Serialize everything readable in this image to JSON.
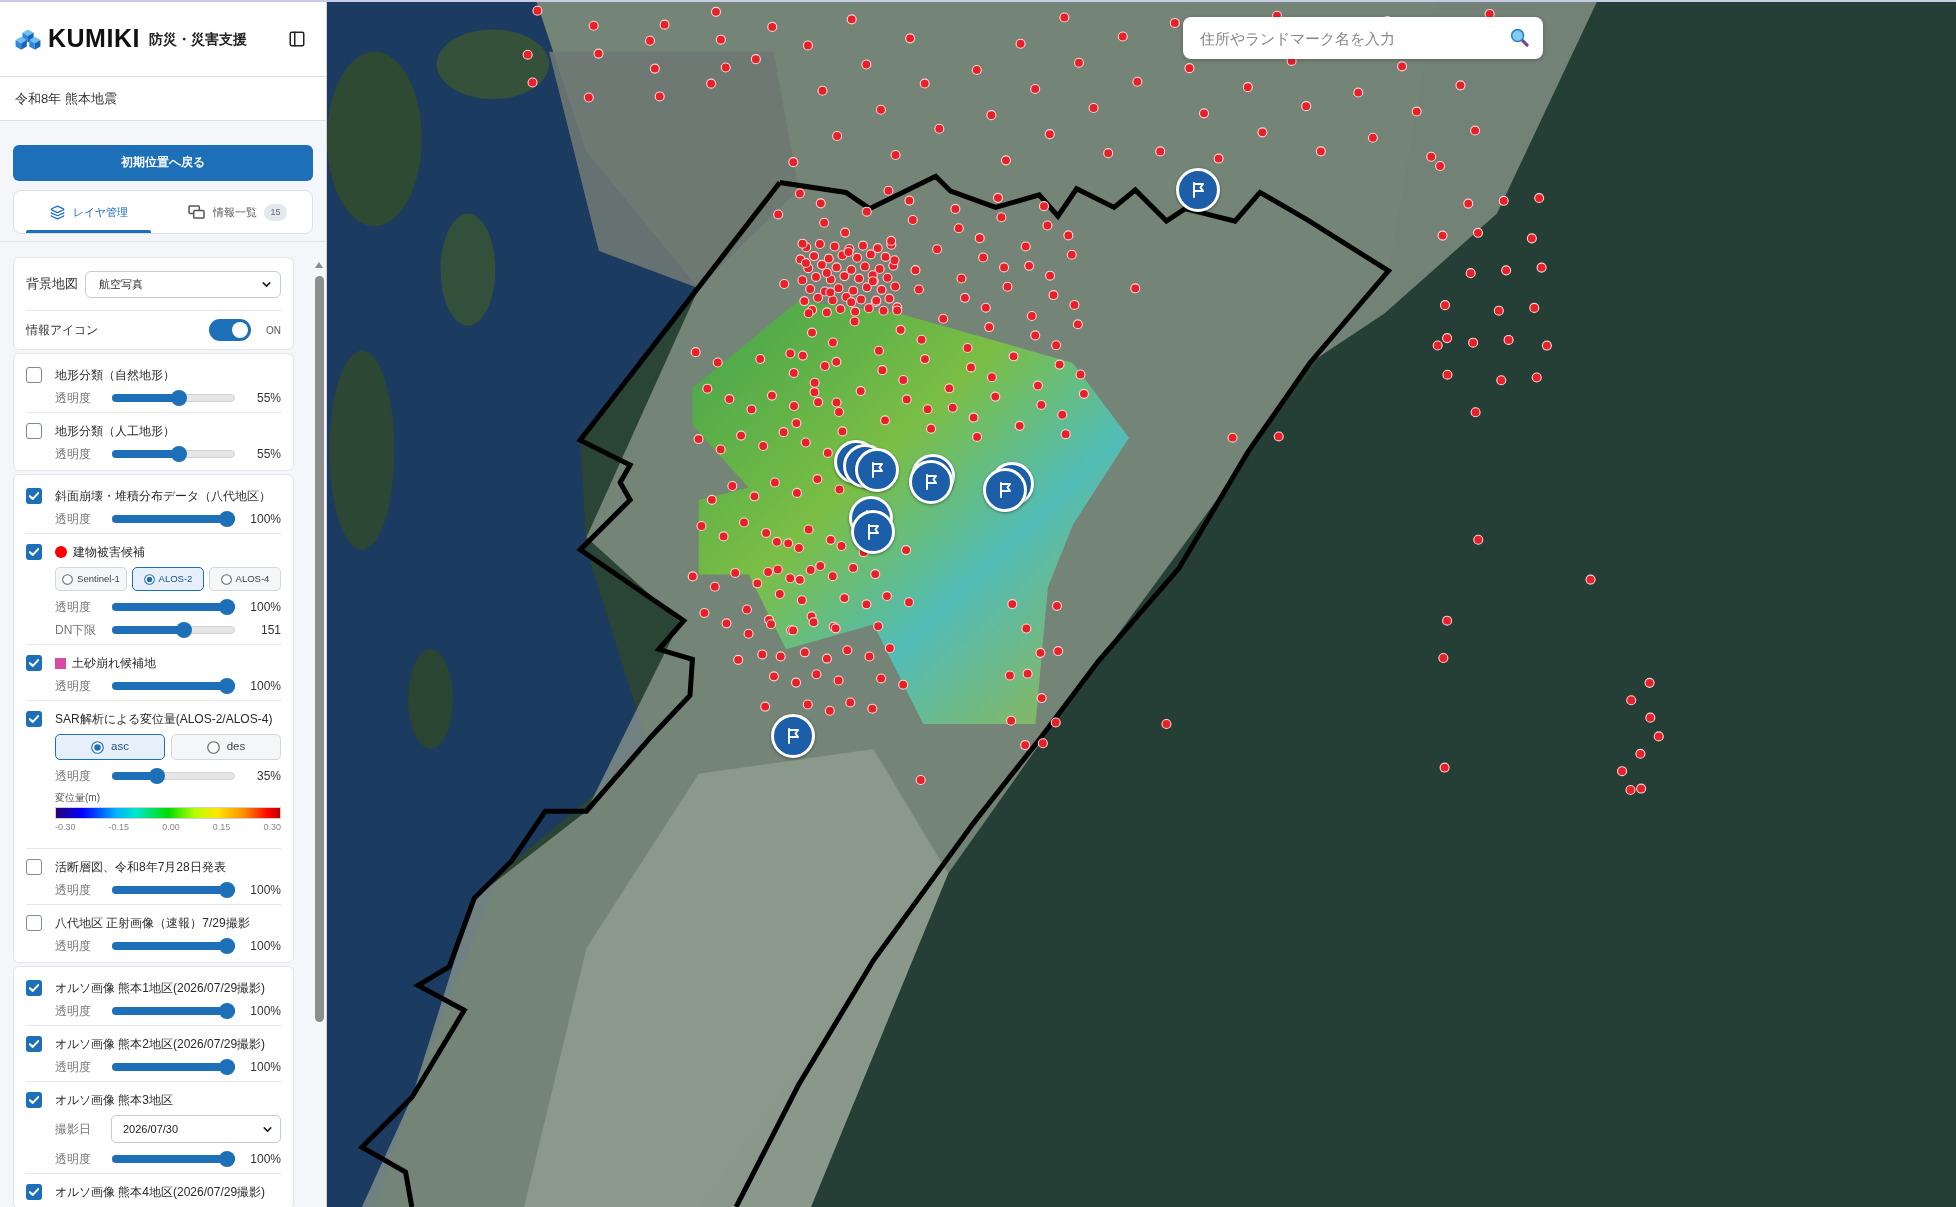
{
  "sidebar": {
    "logo": {
      "name": "KUMIKI",
      "tagline": "防災・災害支援"
    },
    "event_title": "令和8年 熊本地震",
    "reset_button": "初期位置へ戻る",
    "tabs": [
      {
        "label": "レイヤ管理",
        "selected": true
      },
      {
        "label": "情報一覧",
        "selected": false,
        "badge": "15"
      }
    ],
    "basemap": {
      "label": "背景地図",
      "value": "航空写真"
    },
    "info_icons": {
      "label": "情報アイコン",
      "on": true,
      "state_label": "ON"
    },
    "layer_groups": [
      {
        "layers": [
          {
            "name": "地形分類（自然地形）",
            "checked": false,
            "controls": [
              {
                "kind": "slider",
                "label": "透明度",
                "level": 0.55,
                "reading": "55%"
              }
            ]
          },
          {
            "name": "地形分類（人工地形）",
            "checked": false,
            "controls": [
              {
                "kind": "slider",
                "label": "透明度",
                "level": 0.55,
                "reading": "55%"
              }
            ]
          }
        ]
      },
      {
        "layers": [
          {
            "name": "斜面崩壊・堆積分布データ（八代地区）",
            "checked": true,
            "controls": [
              {
                "kind": "slider",
                "label": "透明度",
                "level": 1,
                "reading": "100%"
              }
            ]
          },
          {
            "name": "建物被害候補",
            "checked": true,
            "legend": {
              "kind": "dot",
              "color": "#ff0000"
            },
            "controls": [
              {
                "kind": "radio_group",
                "options": [
                  {
                    "label": "Sentinel-1",
                    "selected": false
                  },
                  {
                    "label": "ALOS-2",
                    "selected": true
                  },
                  {
                    "label": "ALOS-4",
                    "selected": false
                  }
                ]
              },
              {
                "kind": "slider",
                "label": "透明度",
                "level": 1,
                "reading": "100%"
              },
              {
                "kind": "slider",
                "label": "DN下限",
                "level": 0.6,
                "reading": "151"
              }
            ]
          },
          {
            "name": "土砂崩れ候補地",
            "checked": true,
            "legend": {
              "kind": "square",
              "color": "#d94aa5"
            },
            "controls": [
              {
                "kind": "slider",
                "label": "透明度",
                "level": 1,
                "reading": "100%"
              }
            ]
          },
          {
            "name": "SAR解析による変位量(ALOS-2/ALOS-4)",
            "checked": true,
            "controls": [
              {
                "kind": "radio_group",
                "options": [
                  {
                    "label": "asc",
                    "selected": true
                  },
                  {
                    "label": "des",
                    "selected": false
                  }
                ]
              },
              {
                "kind": "slider",
                "label": "透明度",
                "level": 0.35,
                "reading": "35%"
              },
              {
                "kind": "colorbar",
                "title": "変位量(m)",
                "ticks": [
                  "-0.30",
                  "-0.15",
                  "0.00",
                  "0.15",
                  "0.30"
                ]
              }
            ]
          },
          {
            "name": "活断層図、令和8年7月28日発表",
            "checked": false,
            "controls": [
              {
                "kind": "slider",
                "label": "透明度",
                "level": 1,
                "reading": "100%"
              }
            ]
          },
          {
            "name": "八代地区 正射画像（速報）7/29撮影",
            "checked": false,
            "controls": [
              {
                "kind": "slider",
                "label": "透明度",
                "level": 1,
                "reading": "100%"
              }
            ]
          }
        ]
      },
      {
        "layers": [
          {
            "name": "オルソ画像 熊本1地区(2026/07/29撮影)",
            "checked": true,
            "controls": [
              {
                "kind": "slider",
                "label": "透明度",
                "level": 1,
                "reading": "100%"
              }
            ]
          },
          {
            "name": "オルソ画像 熊本2地区(2026/07/29撮影)",
            "checked": true,
            "controls": [
              {
                "kind": "slider",
                "label": "透明度",
                "level": 1,
                "reading": "100%"
              }
            ]
          },
          {
            "name": "オルソ画像 熊本3地区",
            "checked": true,
            "controls": [
              {
                "kind": "select",
                "label": "撮影日",
                "value": "2026/07/30"
              },
              {
                "kind": "slider",
                "label": "透明度",
                "level": 1,
                "reading": "100%"
              }
            ]
          },
          {
            "name": "オルソ画像 熊本4地区(2026/07/29撮影)",
            "checked": true
          }
        ]
      }
    ]
  },
  "map": {
    "search": {
      "placeholder": "住所やランドマーク名を入力"
    }
  }
}
